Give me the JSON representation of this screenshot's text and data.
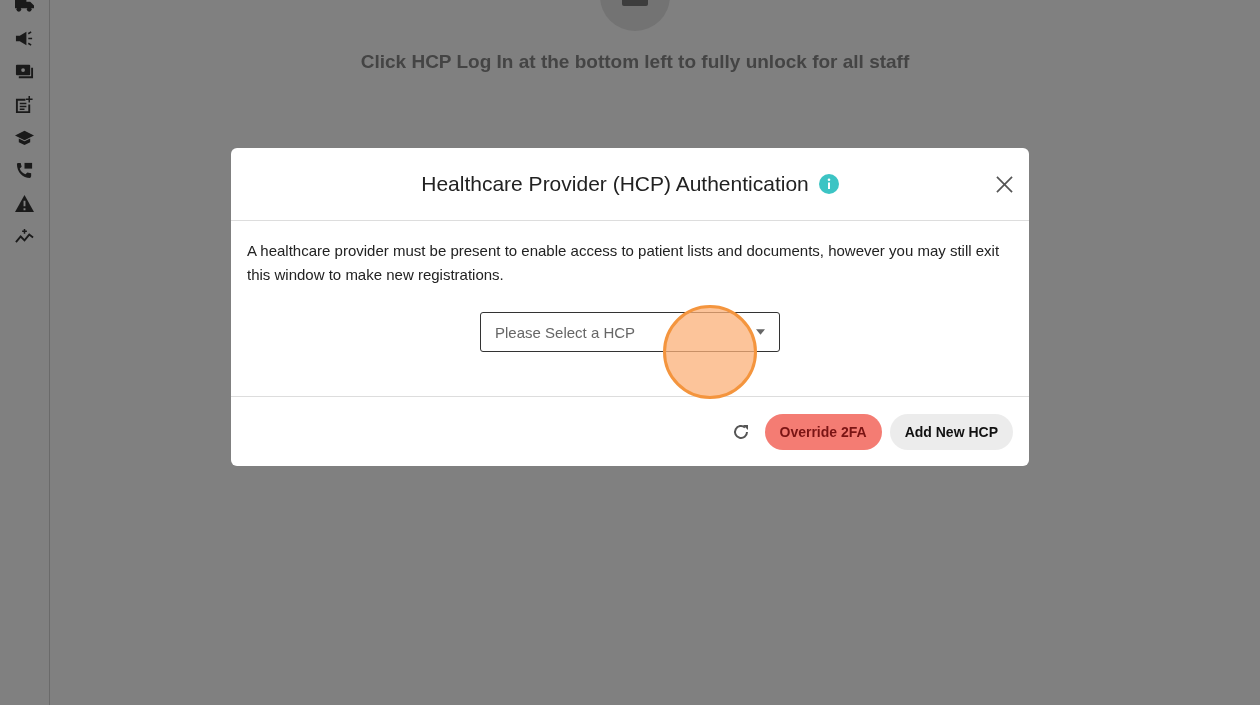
{
  "background": {
    "message": "Click HCP Log In at the bottom left to fully unlock for all staff"
  },
  "modal": {
    "title": "Healthcare Provider (HCP) Authentication",
    "body": "A healthcare provider must be present to enable access to patient lists and documents, however you may still exit this window to make new registrations.",
    "select": {
      "placeholder": "Please Select a HCP"
    },
    "buttons": [
      {
        "label": "Override 2FA",
        "kind": "danger"
      },
      {
        "label": "Add New HCP",
        "kind": "secondary"
      }
    ]
  }
}
